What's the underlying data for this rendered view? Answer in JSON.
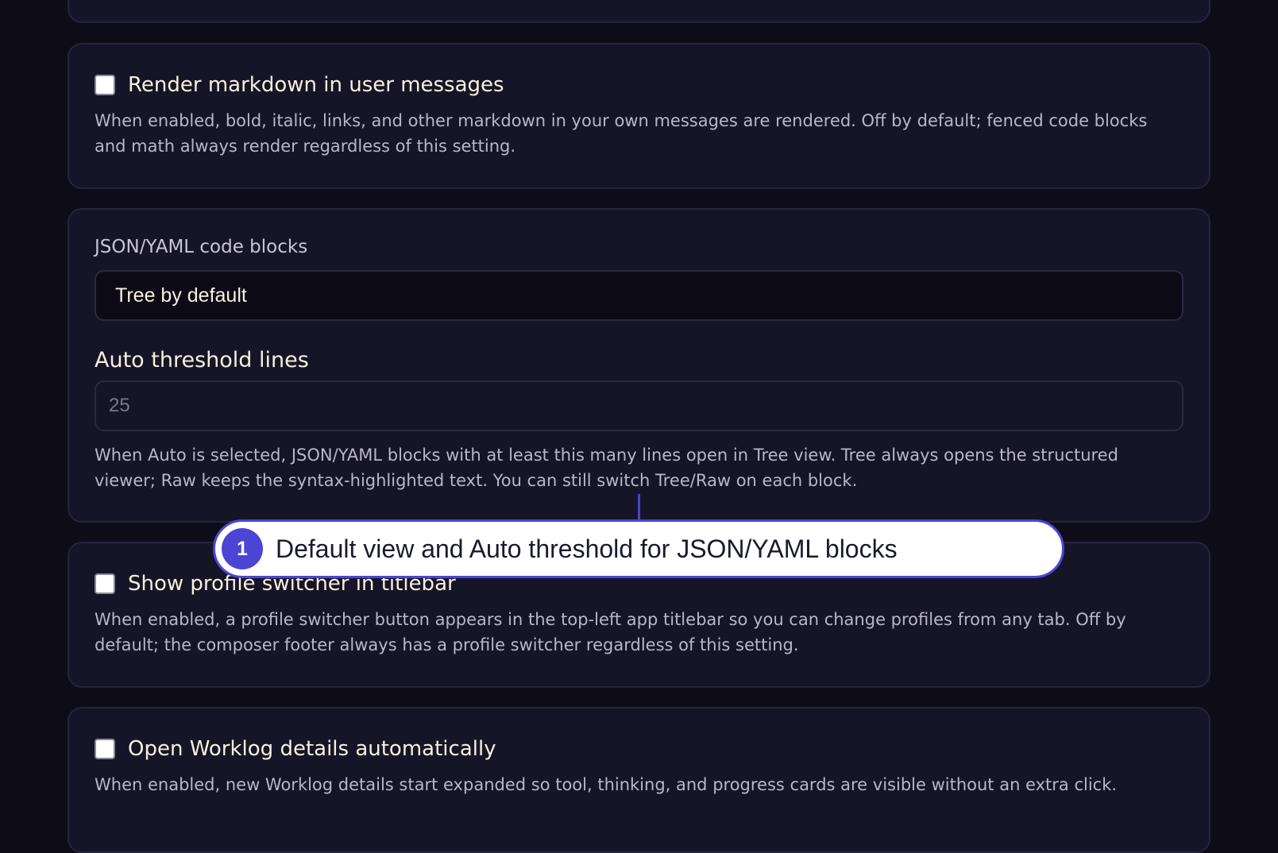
{
  "settings": {
    "render_markdown": {
      "label": "Render markdown in user messages",
      "checked": false,
      "description": "When enabled, bold, italic, links, and other markdown in your own messages are rendered. Off by default; fenced code blocks and math always render regardless of this setting."
    },
    "code_blocks": {
      "label": "JSON/YAML code blocks",
      "selected_value": "Tree by default",
      "threshold_label": "Auto threshold lines",
      "threshold_placeholder": "25",
      "description": "When Auto is selected, JSON/YAML blocks with at least this many lines open in Tree view. Tree always opens the structured viewer; Raw keeps the syntax-highlighted text. You can still switch Tree/Raw on each block."
    },
    "profile_switcher": {
      "label": "Show profile switcher in titlebar",
      "checked": false,
      "description": "When enabled, a profile switcher button appears in the top-left app titlebar so you can change profiles from any tab. Off by default; the composer footer always has a profile switcher regardless of this setting."
    },
    "worklog": {
      "label": "Open Worklog details automatically",
      "checked": false,
      "description": "When enabled, new Worklog details start expanded so tool, thinking, and progress cards are visible without an extra click."
    }
  },
  "annotation": {
    "number": "1",
    "text": "Default view and Auto threshold for JSON/YAML blocks",
    "accent_color": "#4c45d4"
  }
}
